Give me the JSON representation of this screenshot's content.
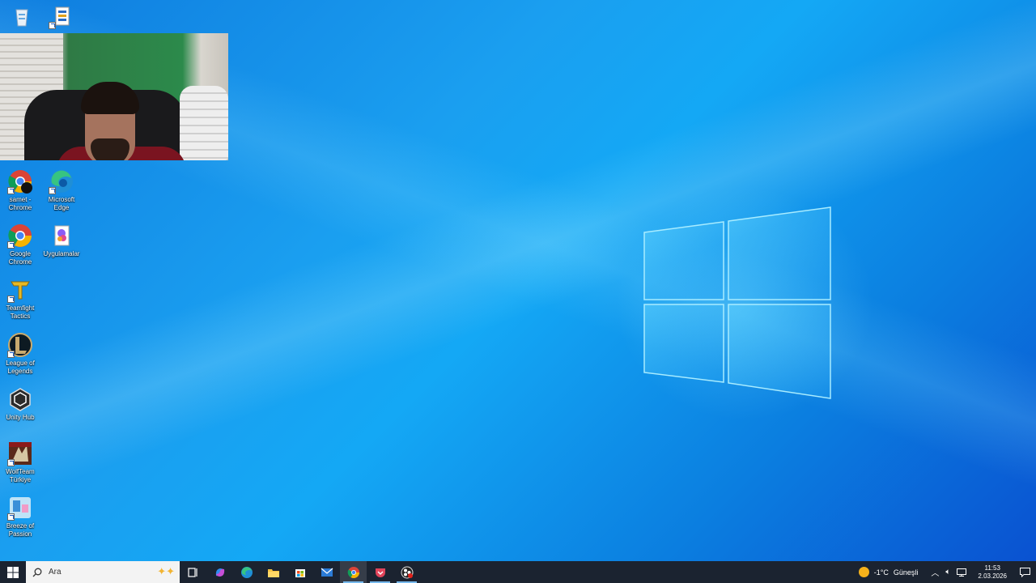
{
  "desktop_icons": [
    {
      "name": "recycle-bin",
      "label": ""
    },
    {
      "name": "file",
      "label": ""
    },
    {
      "name": "samet-chrome",
      "label": "samet - Chrome"
    },
    {
      "name": "microsoft-edge",
      "label": "Microsoft Edge"
    },
    {
      "name": "google-chrome",
      "label": "Google Chrome"
    },
    {
      "name": "uygulamalar",
      "label": "Uygulamalar"
    },
    {
      "name": "teamfight-tactics",
      "label": "Teamfight Tactics"
    },
    {
      "name": "league-of-legends",
      "label": "League of Legends"
    },
    {
      "name": "unity-hub",
      "label": "Unity Hub"
    },
    {
      "name": "wolfteam-turkiye",
      "label": "WolfTeam Türkiye"
    },
    {
      "name": "breeze-of-passion",
      "label": "Breeze of Passion"
    }
  ],
  "taskbar": {
    "search_placeholder": "Ara",
    "apps": [
      "task-view-icon",
      "copilot-icon",
      "edge-icon",
      "file-explorer-icon",
      "store-icon",
      "mail-icon",
      "chrome-icon",
      "pocket-icon",
      "obs-icon"
    ]
  },
  "tray": {
    "temperature": "-1°C",
    "weather_text": "Güneşli",
    "time": "11:53",
    "date": "2.03.2026"
  },
  "colors": {
    "taskbar": "#1b2330",
    "desktop_accent": "#1a9ff0"
  }
}
